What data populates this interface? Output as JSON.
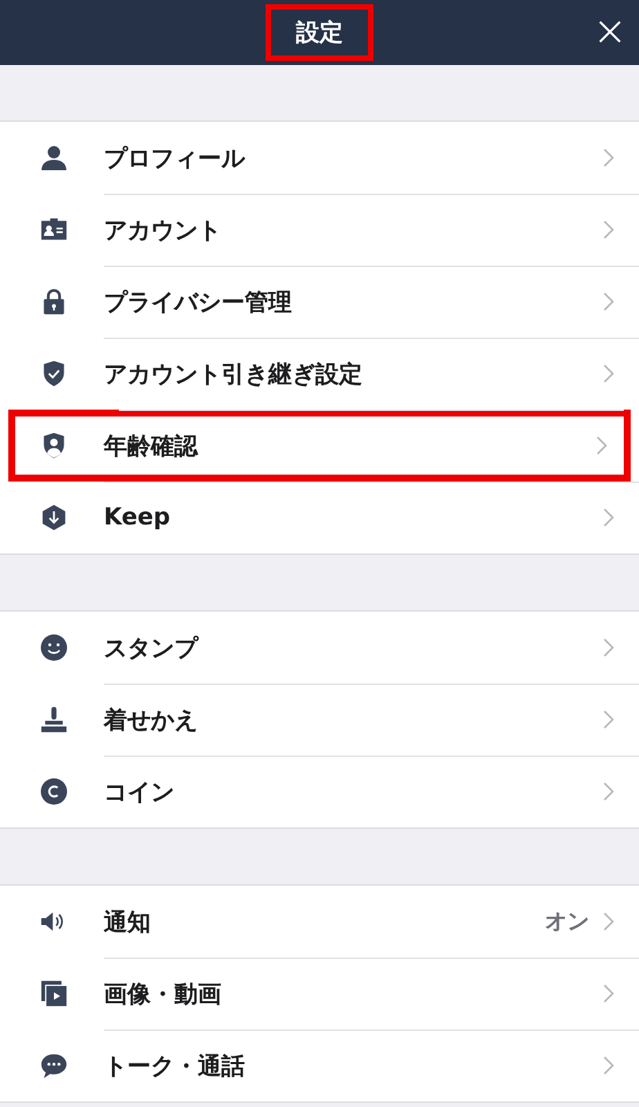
{
  "header": {
    "title": "設定",
    "highlighted": true
  },
  "sections": [
    {
      "items": [
        {
          "label": "プロフィール",
          "highlighted": false
        },
        {
          "label": "アカウント",
          "highlighted": false
        },
        {
          "label": "プライバシー管理",
          "highlighted": false
        },
        {
          "label": "アカウント引き継ぎ設定",
          "highlighted": false
        },
        {
          "label": "年齢確認",
          "highlighted": true
        },
        {
          "label": "Keep",
          "highlighted": false
        }
      ]
    },
    {
      "items": [
        {
          "label": "スタンプ",
          "highlighted": false
        },
        {
          "label": "着せかえ",
          "highlighted": false
        },
        {
          "label": "コイン",
          "highlighted": false
        }
      ]
    },
    {
      "items": [
        {
          "label": "通知",
          "value": "オン",
          "highlighted": false
        },
        {
          "label": "画像・動画",
          "highlighted": false
        },
        {
          "label": "トーク・通話",
          "highlighted": false
        }
      ]
    }
  ]
}
